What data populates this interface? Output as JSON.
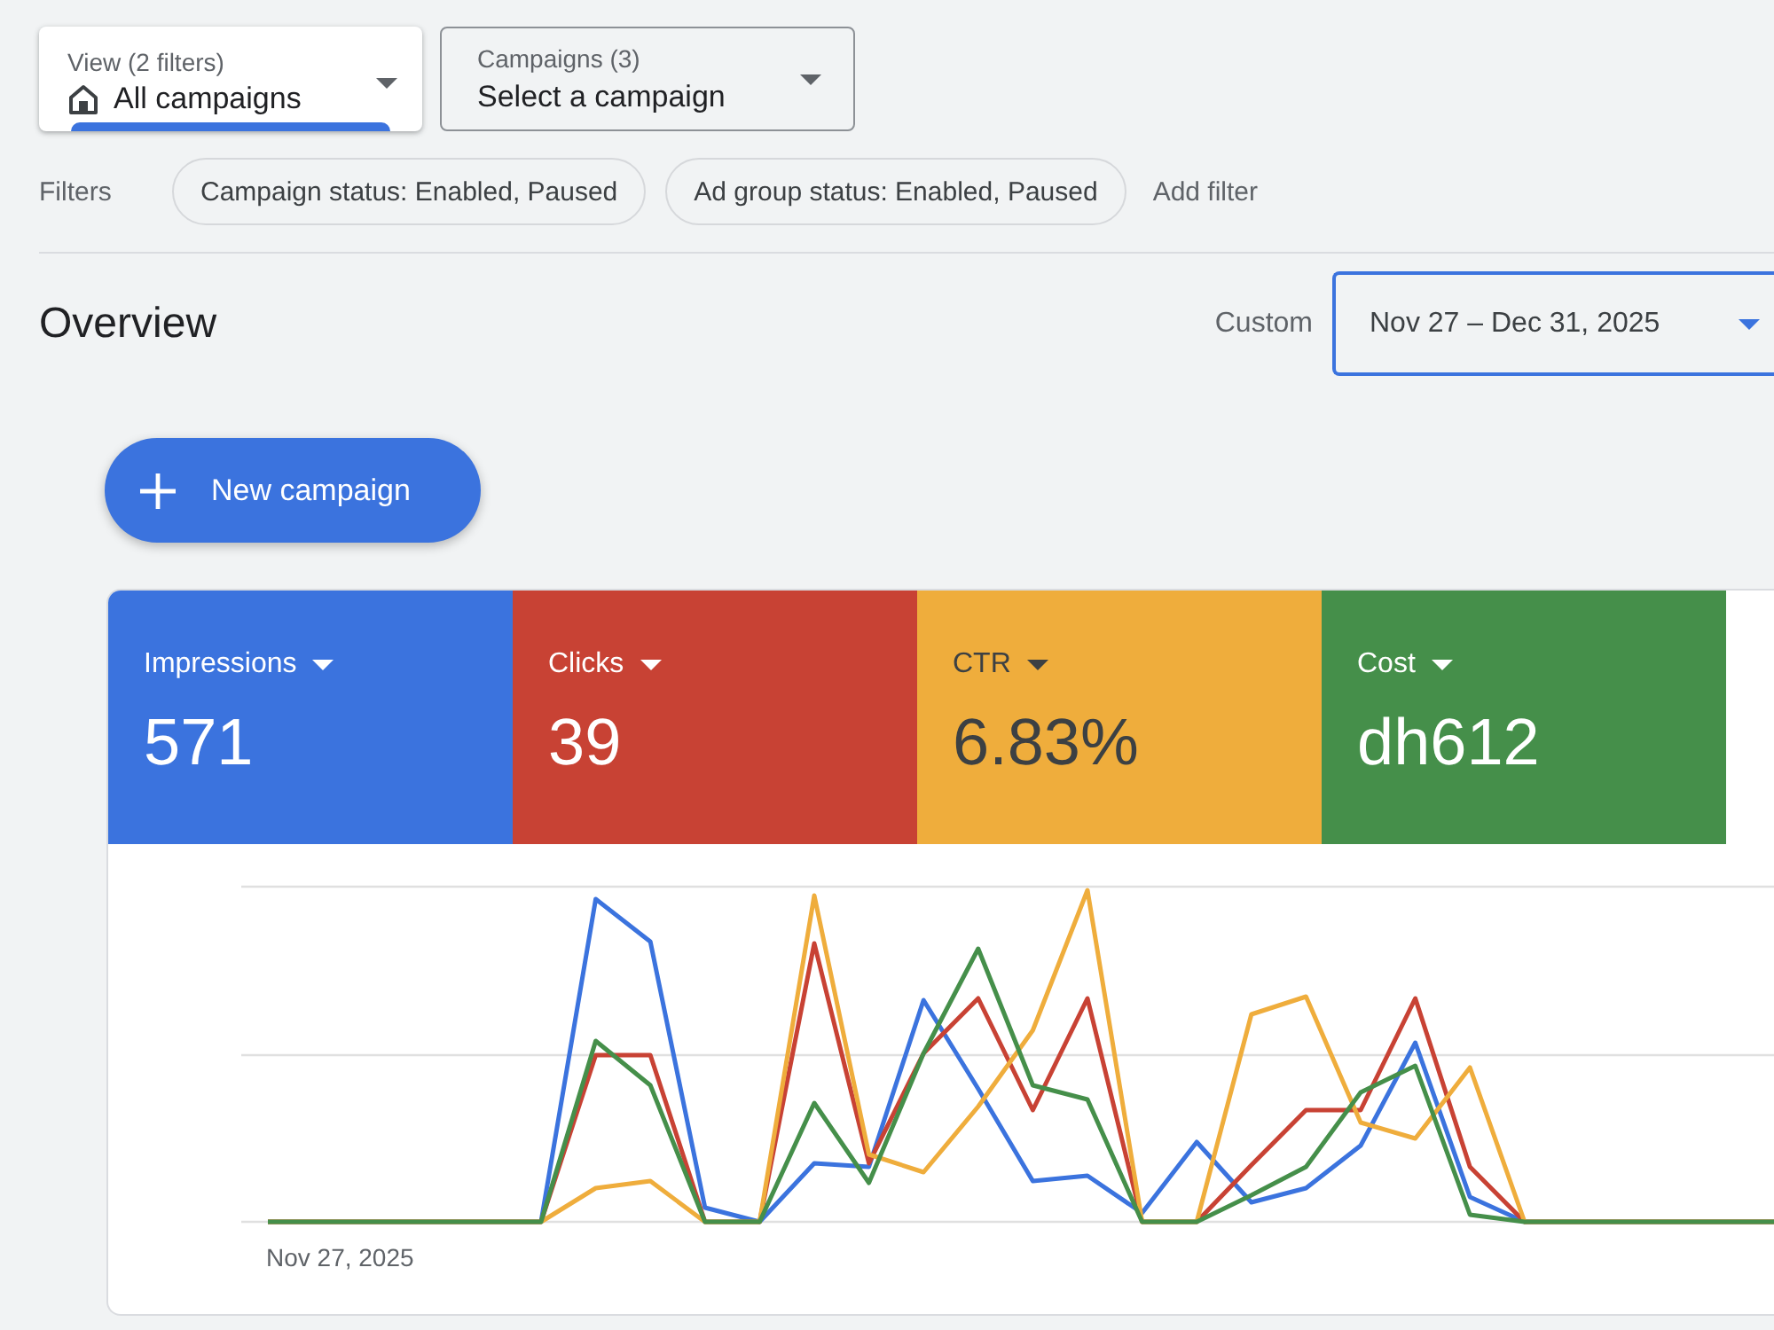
{
  "view_dropdown": {
    "label": "View (2 filters)",
    "value": "All campaigns",
    "selected": true
  },
  "campaign_dropdown": {
    "label": "Campaigns (3)",
    "value": "Select a campaign"
  },
  "filters": {
    "label": "Filters",
    "chips": [
      "Campaign status: Enabled, Paused",
      "Ad group status: Enabled, Paused"
    ],
    "add_filter": "Add filter"
  },
  "overview": {
    "title": "Overview",
    "date_range_label": "Custom",
    "date_range": "Nov 27 – Dec 31, 2025"
  },
  "new_campaign_button": "New campaign",
  "metrics": [
    {
      "label": "Impressions",
      "value": "571",
      "color": "#3b73de"
    },
    {
      "label": "Clicks",
      "value": "39",
      "color": "#c84234"
    },
    {
      "label": "CTR",
      "value": "6.83%",
      "color": "#efad3c"
    },
    {
      "label": "Cost",
      "value": "dh612",
      "color": "#458f4a"
    }
  ],
  "chart": {
    "x_start_label": "Nov 27, 2025"
  }
}
